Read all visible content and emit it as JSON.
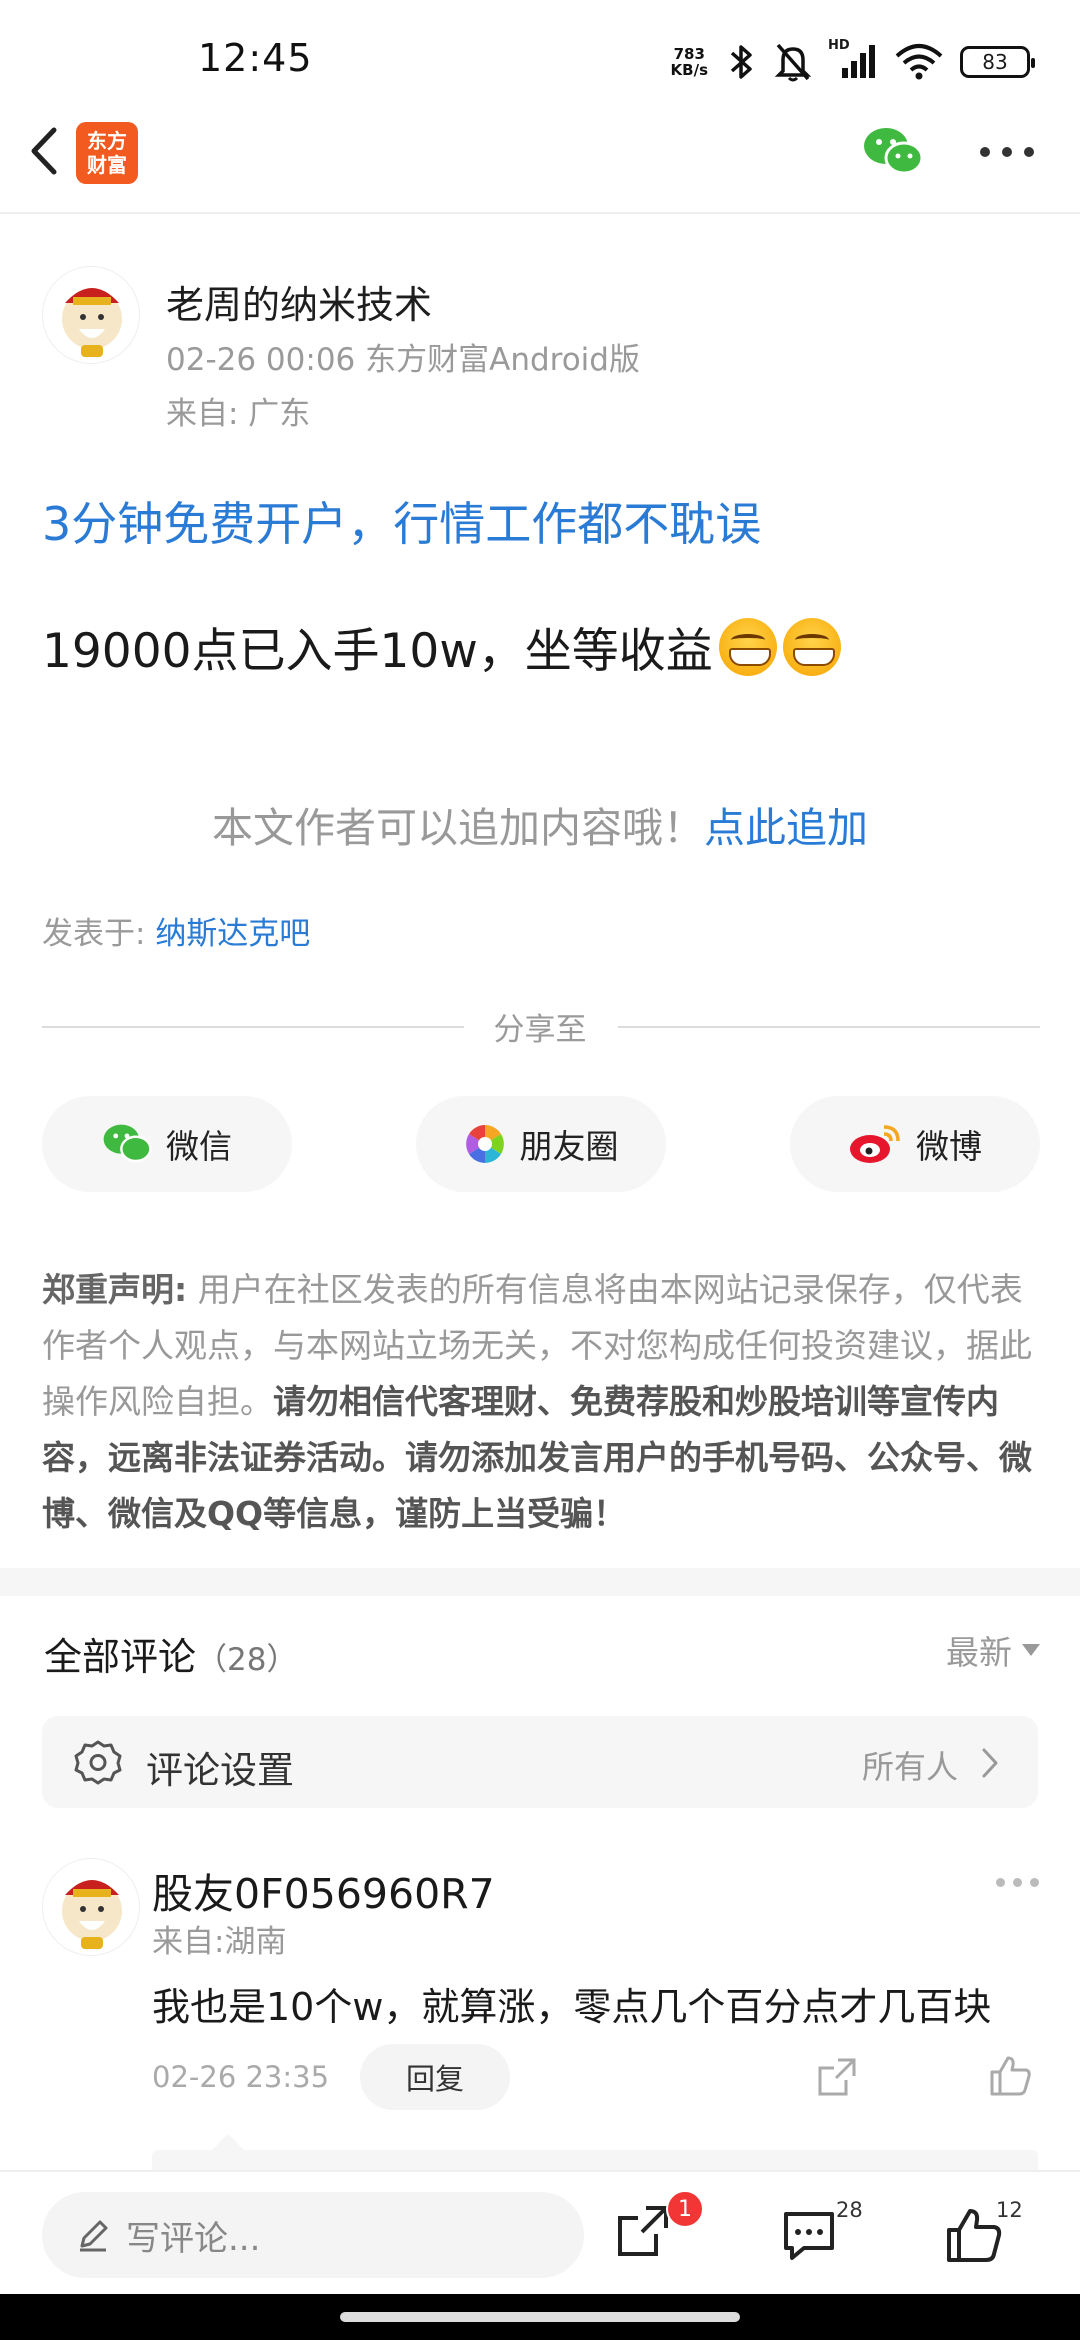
{
  "status_bar": {
    "time": "12:45",
    "net_speed_value": "783",
    "net_speed_unit": "KB/s",
    "signal_label": "HD",
    "battery": "83"
  },
  "nav": {
    "logo_line1": "东方",
    "logo_line2": "财富"
  },
  "post": {
    "author": "老周的纳米技术",
    "meta": "02-26 00:06 东方财富Android版",
    "location": "来自: 广东",
    "promo_link": "3分钟免费开户，行情工作都不耽误",
    "body": "19000点已入手10w，坐等收益",
    "append_tip": "本文作者可以追加内容哦！",
    "append_link": "点此追加",
    "posted_in_label": "发表于: ",
    "posted_in_bar": "纳斯达克吧"
  },
  "share": {
    "title": "分享至",
    "buttons": [
      {
        "label": "微信",
        "icon": "wechat-icon"
      },
      {
        "label": "朋友圈",
        "icon": "moments-icon"
      },
      {
        "label": "微博",
        "icon": "weibo-icon"
      }
    ]
  },
  "disclaimer": {
    "heading": "郑重声明:",
    "normal": " 用户在社区发表的所有信息将由本网站记录保存，仅代表作者个人观点，与本网站立场无关，不对您构成任何投资建议，据此操作风险自担。",
    "bold": "请勿相信代客理财、免费荐股和炒股培训等宣传内容，远离非法证券活动。请勿添加发言用户的手机号码、公众号、微博、微信及QQ等信息，谨防上当受骗！"
  },
  "comments": {
    "title": "全部评论",
    "count": "（28）",
    "sort": "最新",
    "settings_label": "评论设置",
    "settings_value": "所有人",
    "items": [
      {
        "name": "股友0F056960R7",
        "location": "来自:湖南",
        "text": "我也是10个w，就算涨，零点几个百分点才几百块",
        "time": "02-26 23:35",
        "reply_label": "回复"
      }
    ]
  },
  "bottom_bar": {
    "write_placeholder": "写评论...",
    "share_badge": "1",
    "comment_count": "28",
    "like_count": "12"
  },
  "colors": {
    "link": "#2a7bd6",
    "brand": "#f25a1f",
    "badge": "#f23535"
  }
}
